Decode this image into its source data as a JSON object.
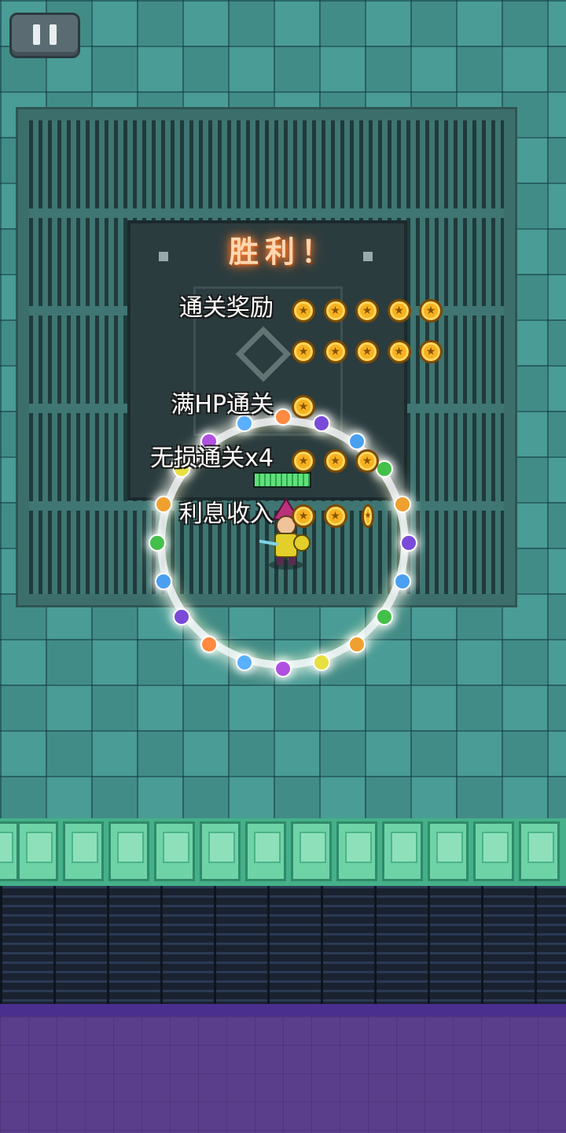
{
  "hud": {
    "pause_icon": "pause-icon"
  },
  "victory": {
    "title": "胜利！",
    "rows": [
      {
        "label": "通关奖励",
        "coins": 10
      },
      {
        "label": "满HP通关",
        "coins": 1
      },
      {
        "label": "无损通关x4",
        "coins": 3
      },
      {
        "label": "利息收入",
        "coins": 2.5
      }
    ]
  },
  "colors": {
    "coin": "#f6b21f",
    "title_glow": "#ff8a3a",
    "floor": "#4a9c96"
  }
}
